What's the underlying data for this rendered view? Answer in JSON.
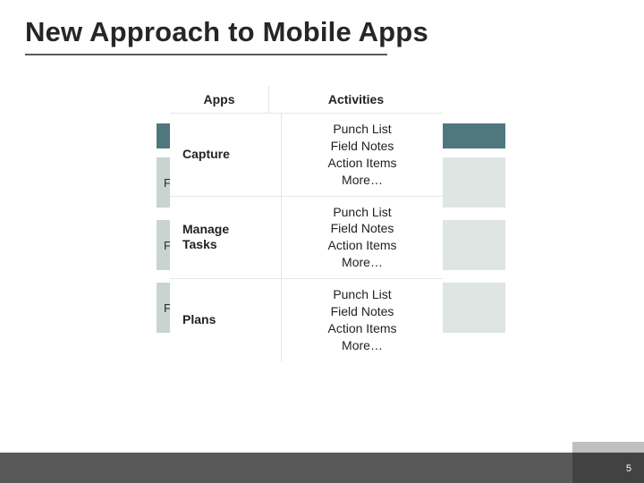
{
  "page": {
    "title": "New Approach to Mobile Apps",
    "number": "5"
  },
  "table": {
    "headers": {
      "apps": "Apps",
      "activities": "Activities"
    },
    "rows": [
      {
        "app": "Capture",
        "activities": [
          "Punch List",
          "Field Notes",
          "Action Items",
          "More…"
        ]
      },
      {
        "app": "Manage\nTasks",
        "activities": [
          "Punch List",
          "Field Notes",
          "Action Items",
          "More…"
        ]
      },
      {
        "app": "Plans",
        "activities": [
          "Punch List",
          "Field Notes",
          "Action Items",
          "More…"
        ]
      }
    ]
  },
  "back_pills_visible_text": [
    "F",
    "F",
    "F"
  ]
}
